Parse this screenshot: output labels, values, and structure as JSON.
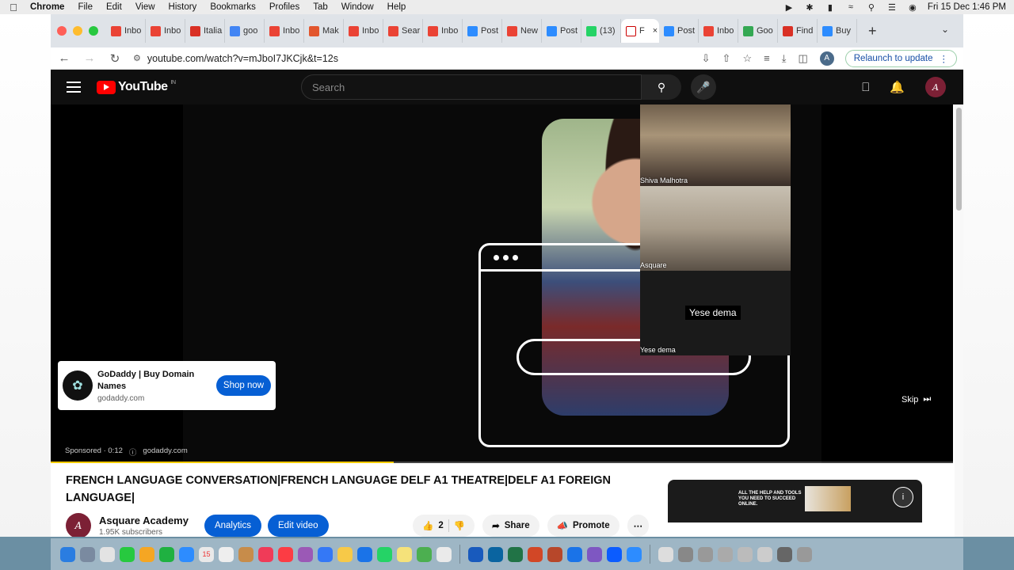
{
  "menubar": {
    "app": "Chrome",
    "items": [
      "File",
      "Edit",
      "View",
      "History",
      "Bookmarks",
      "Profiles",
      "Tab",
      "Window",
      "Help"
    ],
    "datetime": "Fri 15 Dec  1:46 PM"
  },
  "tabs": [
    {
      "label": "Inbo",
      "color": "#ea4335",
      "icon": "gmail-icon"
    },
    {
      "label": "Inbo",
      "color": "#ea4335",
      "icon": "gmail-icon"
    },
    {
      "label": "Italia",
      "color": "#d93025",
      "icon": "star-icon"
    },
    {
      "label": "goo",
      "color": "#4285f4",
      "icon": "google-icon"
    },
    {
      "label": "Inbo",
      "color": "#ea4335",
      "icon": "gmail-icon"
    },
    {
      "label": "Mak",
      "color": "#e2562e",
      "icon": "make-icon"
    },
    {
      "label": "Inbo",
      "color": "#ea4335",
      "icon": "gmail-icon"
    },
    {
      "label": "Sear",
      "color": "#ea4335",
      "icon": "gmail-icon"
    },
    {
      "label": "Inbo",
      "color": "#ea4335",
      "icon": "gmail-icon"
    },
    {
      "label": "Post",
      "color": "#2d8cff",
      "icon": "zoom-icon"
    },
    {
      "label": "New",
      "color": "#ea4335",
      "icon": "gmail-icon"
    },
    {
      "label": "Post",
      "color": "#2d8cff",
      "icon": "zoom-icon"
    },
    {
      "label": "(13)",
      "color": "#25d366",
      "icon": "whatsapp-icon"
    },
    {
      "label": "F",
      "color": "#ffffff",
      "icon": "youtube-icon",
      "active": true
    },
    {
      "label": "Post",
      "color": "#2d8cff",
      "icon": "zoom-icon"
    },
    {
      "label": "Inbo",
      "color": "#ea4335",
      "icon": "gmail-icon"
    },
    {
      "label": "Goo",
      "color": "#34a853",
      "icon": "maps-icon"
    },
    {
      "label": "Find",
      "color": "#d93025",
      "icon": "maple-icon"
    },
    {
      "label": "Buy",
      "color": "#2d8cff",
      "icon": "zoom-icon"
    }
  ],
  "omnibox": {
    "url": "youtube.com/watch?v=mJboI7JKCjk&t=12s"
  },
  "relaunch_label": "Relaunch to update",
  "profile_initial": "A",
  "youtube": {
    "logo_text": "YouTube",
    "region": "IN",
    "search_placeholder": "Search",
    "participants": [
      {
        "name": "Shiva Malhotra"
      },
      {
        "name": "Asquare"
      },
      {
        "name": "Yese dema",
        "caption": "Yese dema"
      }
    ],
    "ad": {
      "title": "GoDaddy | Buy Domain Names",
      "domain": "godaddy.com",
      "cta": "Shop now",
      "sponsored": "Sponsored · 0:12",
      "sponsored_domain": "godaddy.com"
    },
    "skip_label": "Skip",
    "progress": 0.38,
    "video_title": "FRENCH LANGUAGE CONVERSATION|FRENCH LANGUAGE DELF A1 THEATRE|DELF A1 FOREIGN LANGUAGE|",
    "channel": {
      "name": "Asquare Academy",
      "subscribers": "1.95K subscribers",
      "avatar_initial": "A"
    },
    "analytics_label": "Analytics",
    "edit_label": "Edit video",
    "likes": "2",
    "share_label": "Share",
    "promote_label": "Promote",
    "promo_text": "ALL THE HELP AND TOOLS YOU NEED TO SUCCEED ONLINE."
  },
  "dock_calendar_day": "15"
}
